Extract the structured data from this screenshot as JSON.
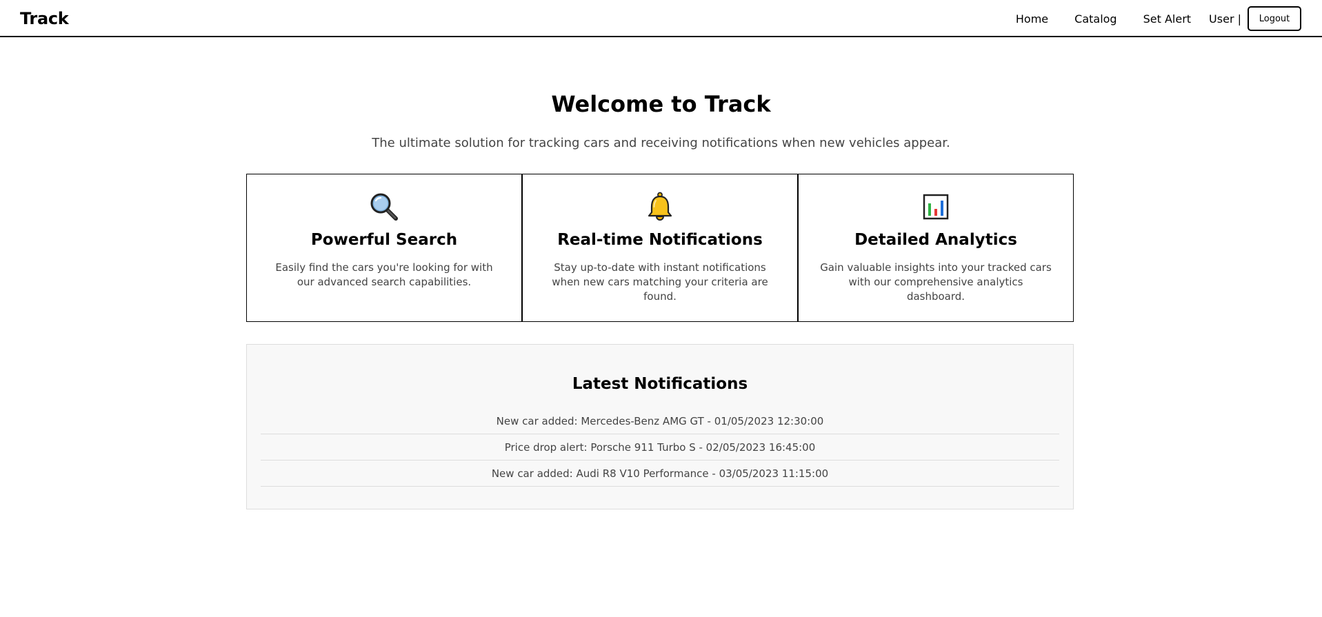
{
  "navbar": {
    "brand": "Track",
    "links": [
      "Home",
      "Catalog",
      "Set Alert"
    ],
    "user_label": "User |",
    "logout_label": "Logout"
  },
  "hero": {
    "title": "Welcome to Track",
    "subtitle": "The ultimate solution for tracking cars and receiving notifications when new vehicles appear."
  },
  "features": [
    {
      "icon": "magnifying-glass-icon",
      "title": "Powerful Search",
      "description": "Easily find the cars you're looking for with our advanced search capabilities."
    },
    {
      "icon": "bell-icon",
      "title": "Real-time Notifications",
      "description": "Stay up-to-date with instant notifications when new cars matching your criteria are found."
    },
    {
      "icon": "bar-chart-icon",
      "title": "Detailed Analytics",
      "description": "Gain valuable insights into your tracked cars with our comprehensive analytics dashboard."
    }
  ],
  "notifications": {
    "title": "Latest Notifications",
    "items": [
      "New car added: Mercedes-Benz AMG GT - 01/05/2023 12:30:00",
      "Price drop alert: Porsche 911 Turbo S - 02/05/2023 16:45:00",
      "New car added: Audi R8 V10 Performance - 03/05/2023 11:15:00"
    ]
  },
  "colors": {
    "text": "#000000",
    "muted_text": "#444444",
    "panel_background": "#f8f8f8",
    "divider": "#dddddd",
    "bell": "#f5b400",
    "magnifier_glass": "#6fa8dc"
  }
}
